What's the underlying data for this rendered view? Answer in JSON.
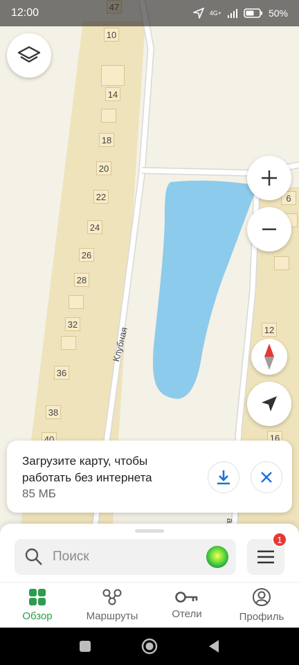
{
  "status_bar": {
    "time": "12:00",
    "network": "4G+",
    "battery": "50%"
  },
  "map": {
    "houses_left": [
      "10",
      "",
      "14",
      "",
      "18",
      "20",
      "22",
      "",
      "24",
      "26",
      "28",
      "",
      "32",
      "",
      "36",
      "",
      "38",
      "40"
    ],
    "houses_right": [
      "6",
      "",
      "",
      "12",
      "16"
    ],
    "street_label": "Клубная",
    "top_partial_label": "47",
    "right_partial_label": "ас"
  },
  "controls": {
    "layers_icon": "layers-icon",
    "zoom_in_icon": "plus-icon",
    "zoom_out_icon": "minus-icon",
    "compass_icon": "compass-icon",
    "locate_icon": "navigation-arrow-icon"
  },
  "banner": {
    "message": "Загрузите карту, чтобы работать без интернета",
    "size": "85 МБ",
    "download_icon": "download-icon",
    "close_icon": "close-icon"
  },
  "search": {
    "placeholder": "Поиск",
    "badge_count": "1"
  },
  "tabs": [
    {
      "label": "Обзор",
      "icon": "grid-icon",
      "active": true
    },
    {
      "label": "Маршруты",
      "icon": "route-icon",
      "active": false
    },
    {
      "label": "Отели",
      "icon": "key-icon",
      "active": false
    },
    {
      "label": "Профиль",
      "icon": "profile-icon",
      "active": false
    }
  ],
  "colors": {
    "accent": "#2e9b4e",
    "water": "#8ccbec",
    "road": "#ffffff",
    "land": "#f4f1e6",
    "built_area": "#efe3bb"
  }
}
